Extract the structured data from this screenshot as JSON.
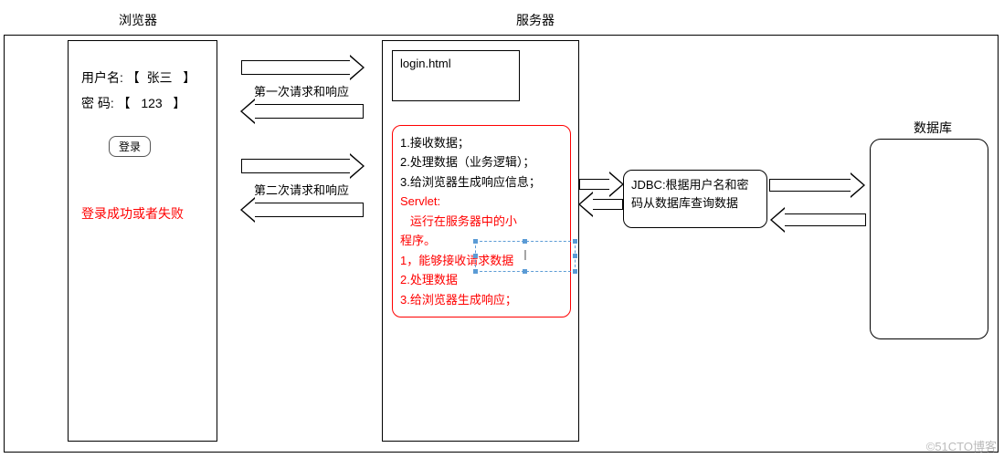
{
  "titles": {
    "browser": "浏览器",
    "server": "服务器",
    "database": "数据库"
  },
  "browser": {
    "username_label": "用户名:",
    "username_value": "张三",
    "password_label": "密  码:",
    "password_value": "123",
    "login_button": "登录",
    "result_text": "登录成功或者失败"
  },
  "arrows": {
    "req1_label": "第一次请求和响应",
    "req2_label": "第二次请求和响应"
  },
  "server": {
    "login_html": "login.html",
    "servlet": {
      "line1": "1.接收数据；",
      "line2": "2.处理数据（业务逻辑）；",
      "line3": "3.给浏览器生成响应信息；",
      "servlet_title": "Servlet:",
      "servlet_desc1_a": "运行在服务器中的小",
      "servlet_desc1_b": "程序。",
      "servlet_desc2": "1，能够接收请求数据",
      "servlet_desc3": "2.处理数据",
      "servlet_desc4": "3.给浏览器生成响应；"
    }
  },
  "jdbc": {
    "line1": "JDBC:根据用户名和密",
    "line2": "码从数据库查询数据"
  },
  "watermark": "©51CTO博客"
}
